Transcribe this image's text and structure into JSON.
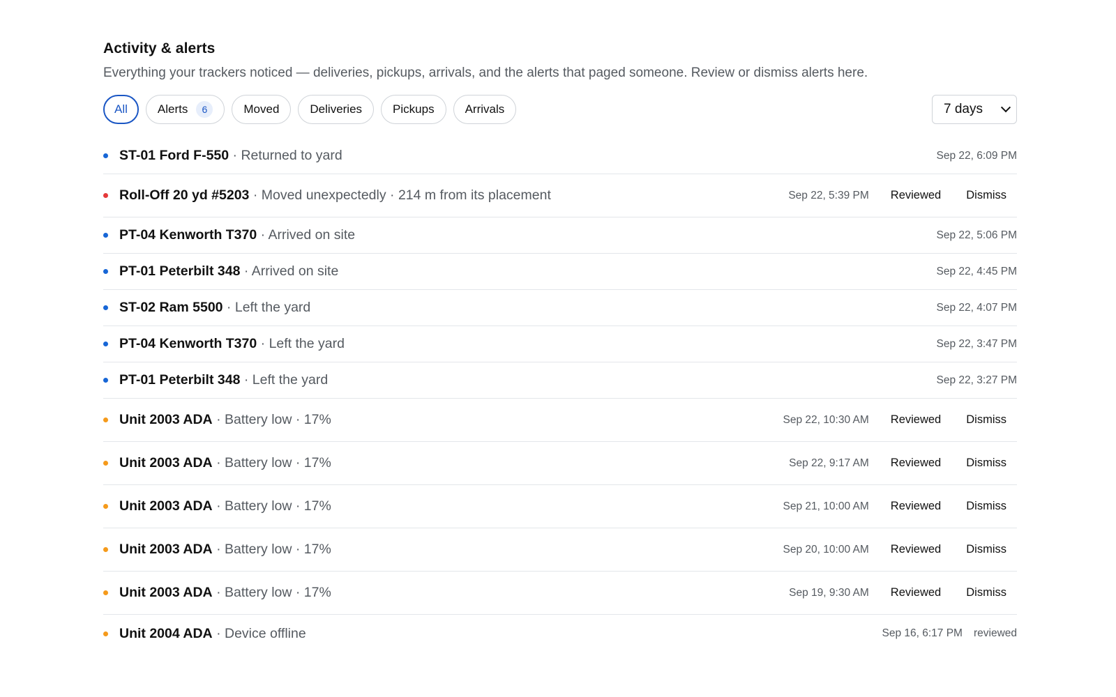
{
  "header": {
    "title": "Activity & alerts",
    "subtitle": "Everything your trackers noticed — deliveries, pickups, arrivals, and the alerts that paged someone. Review or dismiss alerts here."
  },
  "filters": {
    "chips": [
      {
        "label": "All",
        "active": true
      },
      {
        "label": "Alerts",
        "count": "6"
      },
      {
        "label": "Moved"
      },
      {
        "label": "Deliveries"
      },
      {
        "label": "Pickups"
      },
      {
        "label": "Arrivals"
      }
    ],
    "range": {
      "selected": "7 days"
    }
  },
  "actions": {
    "reviewed_label": "Reviewed",
    "dismiss_label": "Dismiss"
  },
  "colors": {
    "info": "#1766d6",
    "critical": "#e5393a",
    "warning": "#f59a1b",
    "accent": "#1a56c4"
  },
  "events": [
    {
      "name": "ST-01 Ford F-550",
      "detail": "Returned to yard",
      "time": "Sep 22, 6:09 PM",
      "status": "info"
    },
    {
      "name": "Roll-Off 20 yd #5203",
      "detail": "Moved unexpectedly · 214 m from its placement",
      "time": "Sep 22, 5:39 PM",
      "status": "critical",
      "actions": true
    },
    {
      "name": "PT-04 Kenworth T370",
      "detail": "Arrived on site",
      "time": "Sep 22, 5:06 PM",
      "status": "info"
    },
    {
      "name": "PT-01 Peterbilt 348",
      "detail": "Arrived on site",
      "time": "Sep 22, 4:45 PM",
      "status": "info"
    },
    {
      "name": "ST-02 Ram 5500",
      "detail": "Left the yard",
      "time": "Sep 22, 4:07 PM",
      "status": "info"
    },
    {
      "name": "PT-04 Kenworth T370",
      "detail": "Left the yard",
      "time": "Sep 22, 3:47 PM",
      "status": "info"
    },
    {
      "name": "PT-01 Peterbilt 348",
      "detail": "Left the yard",
      "time": "Sep 22, 3:27 PM",
      "status": "info"
    },
    {
      "name": "Unit 2003 ADA",
      "detail": "Battery low · 17%",
      "time": "Sep 22, 10:30 AM",
      "status": "warning",
      "actions": true
    },
    {
      "name": "Unit 2003 ADA",
      "detail": "Battery low · 17%",
      "time": "Sep 22, 9:17 AM",
      "status": "warning",
      "actions": true
    },
    {
      "name": "Unit 2003 ADA",
      "detail": "Battery low · 17%",
      "time": "Sep 21, 10:00 AM",
      "status": "warning",
      "actions": true
    },
    {
      "name": "Unit 2003 ADA",
      "detail": "Battery low · 17%",
      "time": "Sep 20, 10:00 AM",
      "status": "warning",
      "actions": true
    },
    {
      "name": "Unit 2003 ADA",
      "detail": "Battery low · 17%",
      "time": "Sep 19, 9:30 AM",
      "status": "warning",
      "actions": true
    },
    {
      "name": "Unit 2004 ADA",
      "detail": "Device offline",
      "time": "Sep 16, 6:17 PM",
      "status": "warning",
      "state": "reviewed"
    }
  ]
}
